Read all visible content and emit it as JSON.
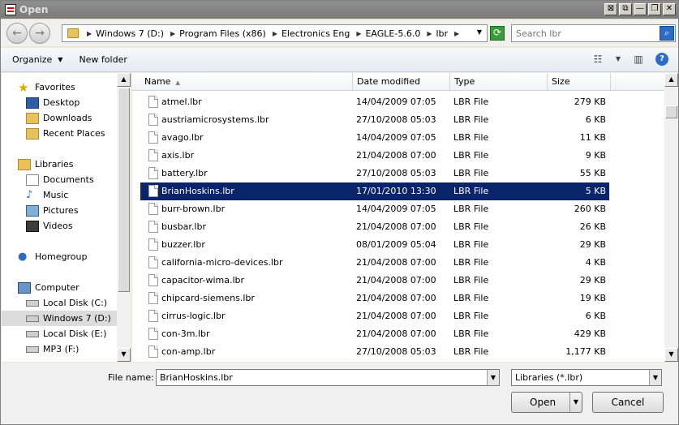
{
  "window": {
    "title": "Open"
  },
  "titlebar_buttons": [
    "⊠",
    "⧉",
    "—",
    "❐",
    "✕"
  ],
  "address": {
    "crumbs": [
      "Windows 7 (D:)",
      "Program Files (x86)",
      "Electronics Eng",
      "EAGLE-5.6.0",
      "lbr"
    ]
  },
  "search": {
    "placeholder": "Search lbr"
  },
  "commands": {
    "organize": "Organize",
    "new_folder": "New folder"
  },
  "nav": {
    "favorites": "Favorites",
    "desktop": "Desktop",
    "downloads": "Downloads",
    "recent": "Recent Places",
    "libraries": "Libraries",
    "documents": "Documents",
    "music": "Music",
    "pictures": "Pictures",
    "videos": "Videos",
    "homegroup": "Homegroup",
    "computer": "Computer",
    "local_c": "Local Disk (C:)",
    "win7_d": "Windows 7 (D:)",
    "local_e": "Local Disk (E:)",
    "mp3_f": "MP3 (F:)"
  },
  "columns": {
    "name": "Name",
    "date": "Date modified",
    "type": "Type",
    "size": "Size"
  },
  "files": [
    {
      "name": "atmel.lbr",
      "date": "14/04/2009 07:05",
      "type": "LBR File",
      "size": "279 KB"
    },
    {
      "name": "austriamicrosystems.lbr",
      "date": "27/10/2008 05:03",
      "type": "LBR File",
      "size": "6 KB"
    },
    {
      "name": "avago.lbr",
      "date": "14/04/2009 07:05",
      "type": "LBR File",
      "size": "11 KB"
    },
    {
      "name": "axis.lbr",
      "date": "21/04/2008 07:00",
      "type": "LBR File",
      "size": "9 KB"
    },
    {
      "name": "battery.lbr",
      "date": "27/10/2008 05:03",
      "type": "LBR File",
      "size": "55 KB"
    },
    {
      "name": "BrianHoskins.lbr",
      "date": "17/01/2010 13:30",
      "type": "LBR File",
      "size": "5 KB"
    },
    {
      "name": "burr-brown.lbr",
      "date": "14/04/2009 07:05",
      "type": "LBR File",
      "size": "260 KB"
    },
    {
      "name": "busbar.lbr",
      "date": "21/04/2008 07:00",
      "type": "LBR File",
      "size": "26 KB"
    },
    {
      "name": "buzzer.lbr",
      "date": "08/01/2009 05:04",
      "type": "LBR File",
      "size": "29 KB"
    },
    {
      "name": "california-micro-devices.lbr",
      "date": "21/04/2008 07:00",
      "type": "LBR File",
      "size": "4 KB"
    },
    {
      "name": "capacitor-wima.lbr",
      "date": "21/04/2008 07:00",
      "type": "LBR File",
      "size": "29 KB"
    },
    {
      "name": "chipcard-siemens.lbr",
      "date": "21/04/2008 07:00",
      "type": "LBR File",
      "size": "19 KB"
    },
    {
      "name": "cirrus-logic.lbr",
      "date": "21/04/2008 07:00",
      "type": "LBR File",
      "size": "6 KB"
    },
    {
      "name": "con-3m.lbr",
      "date": "21/04/2008 07:00",
      "type": "LBR File",
      "size": "429 KB"
    },
    {
      "name": "con-amp.lbr",
      "date": "27/10/2008 05:03",
      "type": "LBR File",
      "size": "1,177 KB"
    }
  ],
  "selected_file": "BrianHoskins.lbr",
  "footer": {
    "filename_label": "File name:",
    "filename_value": "BrianHoskins.lbr",
    "filter": "Libraries (*.lbr)",
    "open": "Open",
    "cancel": "Cancel"
  }
}
